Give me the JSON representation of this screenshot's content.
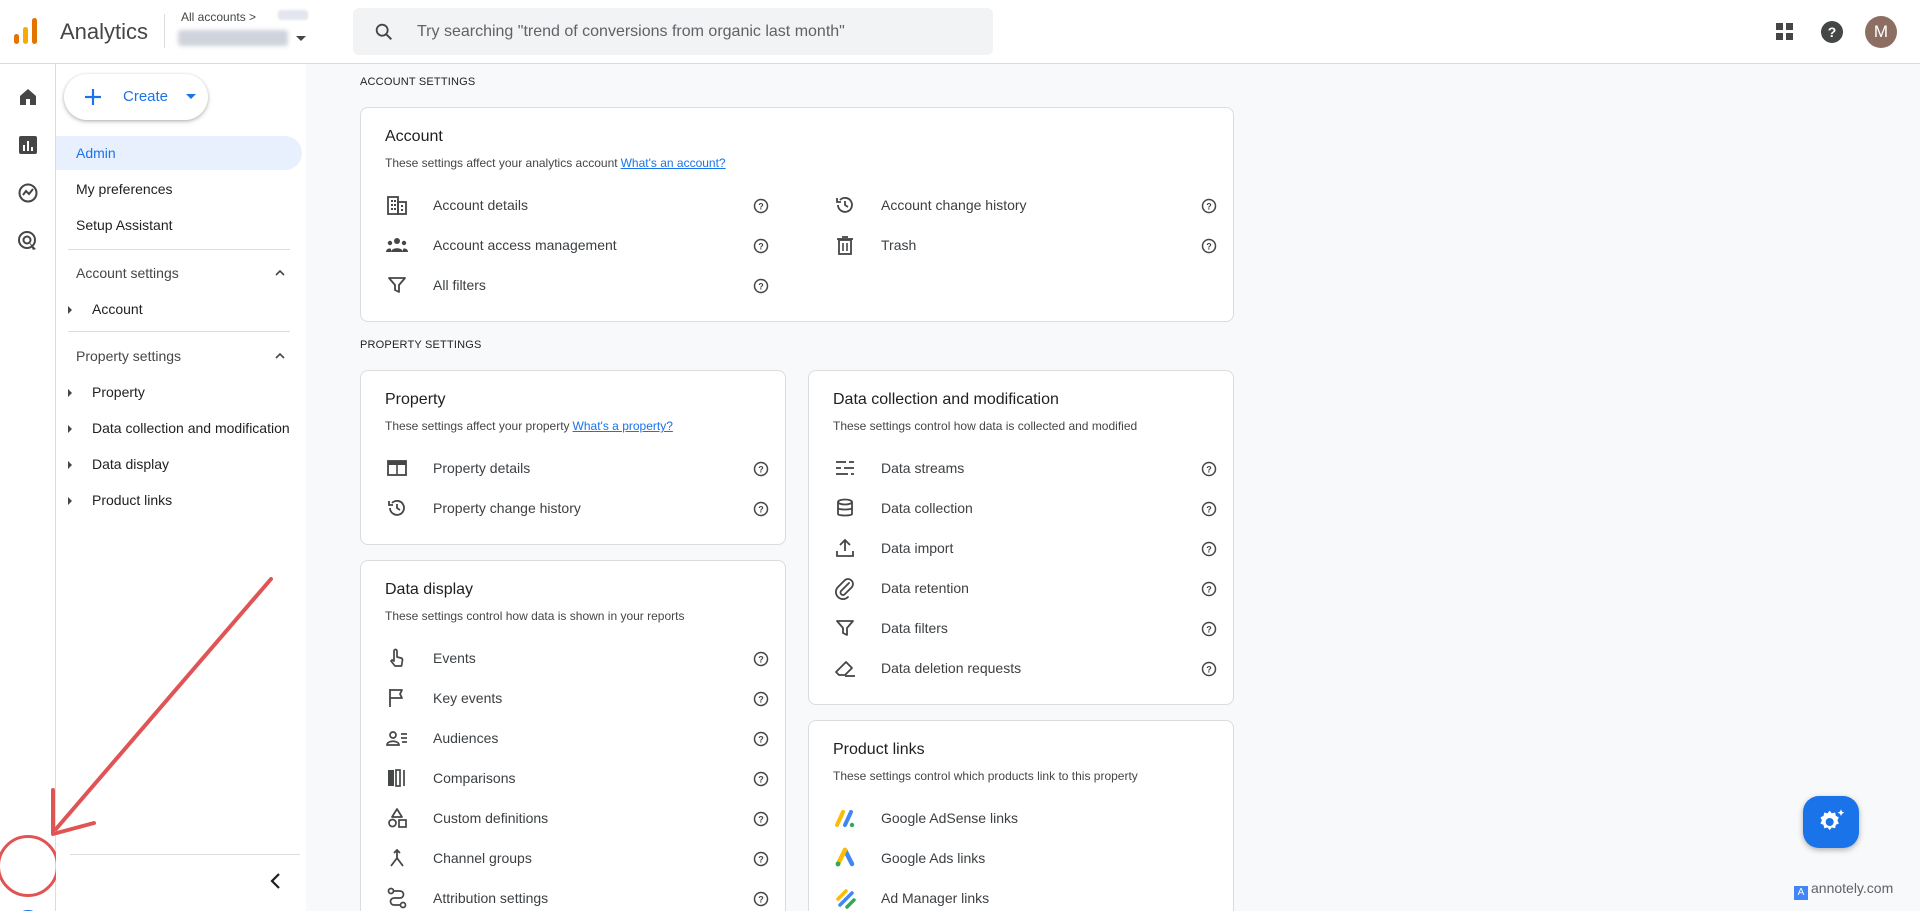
{
  "header": {
    "app_title": "Analytics",
    "account_crumb": "All accounts",
    "search_placeholder": "Try searching \"trend of conversions from organic last month\"",
    "avatar_initial": "M"
  },
  "sidenav": {
    "create_label": "Create",
    "items": [
      {
        "label": "Admin",
        "active": true
      },
      {
        "label": "My preferences"
      },
      {
        "label": "Setup Assistant"
      }
    ],
    "account_section": {
      "title": "Account settings",
      "items": [
        "Account"
      ]
    },
    "property_section": {
      "title": "Property settings",
      "items": [
        "Property",
        "Data collection and modification",
        "Data display",
        "Product links"
      ]
    }
  },
  "main": {
    "account_settings_label": "ACCOUNT SETTINGS",
    "property_settings_label": "PROPERTY SETTINGS",
    "account_card": {
      "title": "Account",
      "desc": "These settings affect your analytics account",
      "link": "What's an account?",
      "left_rows": [
        "Account details",
        "Account access management",
        "All filters"
      ],
      "right_rows": [
        "Account change history",
        "Trash"
      ]
    },
    "property_card": {
      "title": "Property",
      "desc": "These settings affect your property",
      "link": "What's a property?",
      "rows": [
        "Property details",
        "Property change history"
      ]
    },
    "data_collection_card": {
      "title": "Data collection and modification",
      "desc": "These settings control how data is collected and modified",
      "rows": [
        "Data streams",
        "Data collection",
        "Data import",
        "Data retention",
        "Data filters",
        "Data deletion requests"
      ]
    },
    "data_display_card": {
      "title": "Data display",
      "desc": "These settings control how data is shown in your reports",
      "rows": [
        "Events",
        "Key events",
        "Audiences",
        "Comparisons",
        "Custom definitions",
        "Channel groups",
        "Attribution settings"
      ]
    },
    "product_links_card": {
      "title": "Product links",
      "desc": "These settings control which products link to this property",
      "rows": [
        "Google AdSense links",
        "Google Ads links",
        "Ad Manager links"
      ]
    }
  },
  "watermark": "annotely.com",
  "colors": {
    "accent": "#1a73e8",
    "annotation": "#e15455",
    "active_bg": "#e8f0fe"
  }
}
